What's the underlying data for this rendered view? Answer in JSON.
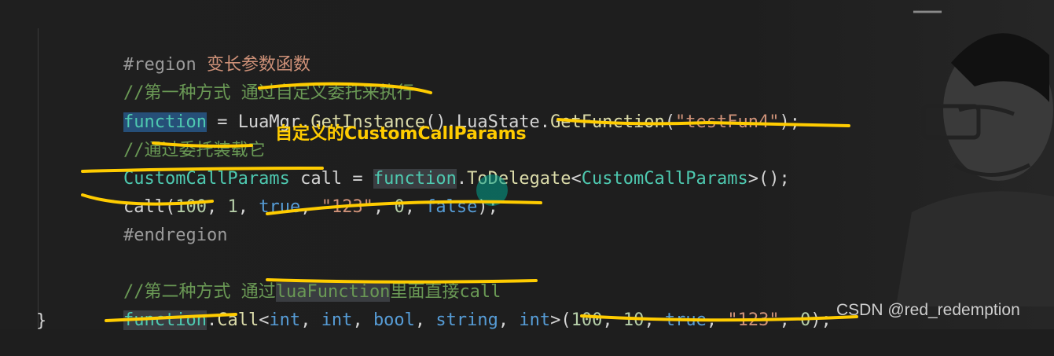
{
  "editor": {
    "lines": {
      "l1": {
        "a": "#region",
        "b": " 变长参数函数"
      },
      "l2": {
        "a": "//第一种方式 通过自定义委托来执行"
      },
      "l3": {
        "a": "function",
        "b": " = LuaMgr.",
        "c": "GetInstance",
        "d": "().LuaState.",
        "e": "GetFunction",
        "f": "(",
        "g": "\"testFun4\"",
        "h": ");"
      },
      "l4": {
        "a": "//通过委托装载它"
      },
      "l5": {
        "a": "CustomCallParams",
        "b": " call = ",
        "c": "function",
        "d": ".",
        "e": "ToDelegate",
        "f": "<",
        "g": "CustomCallParams",
        "h": ">();"
      },
      "l6": {
        "a": "call",
        "b": "(",
        "c": "100",
        "d": ", ",
        "e": "1",
        "f": ", ",
        "g": "true",
        "h": ", ",
        "i": "\"123\"",
        "j": ", ",
        "k": "0",
        "l": ", ",
        "m": "false",
        "n": ");"
      },
      "l7": {
        "a": "#endregion"
      },
      "l8": {
        "a": "//第二种方式 通过",
        "b": "luaFunction",
        "c": "里面直接call"
      },
      "l9": {
        "a": "function",
        "b": ".",
        "c": "Call",
        "d": "<",
        "e": "int",
        "f": ", ",
        "g": "int",
        "h": ", ",
        "i": "bool",
        "j": ", ",
        "k": "string",
        "l": ", ",
        "m": "int",
        "n": ">(",
        "o": "100",
        "p": ", ",
        "q": "10",
        "r": ", ",
        "s": "true",
        "t": ", ",
        "u": "\"123\"",
        "v": ", ",
        "w": "0",
        "x": ");"
      },
      "brace": "}"
    }
  },
  "annotation": "自定义的CustomCallParams",
  "watermark": "CSDN @red_redemption",
  "colors": {
    "keyword": "#569cd6",
    "type": "#4ec9b0",
    "method": "#dcdcaa",
    "string": "#ce9178",
    "number": "#b5cea8",
    "comment": "#6a9955",
    "annotation": "#ffcc00",
    "background": "#1e1e1e"
  }
}
